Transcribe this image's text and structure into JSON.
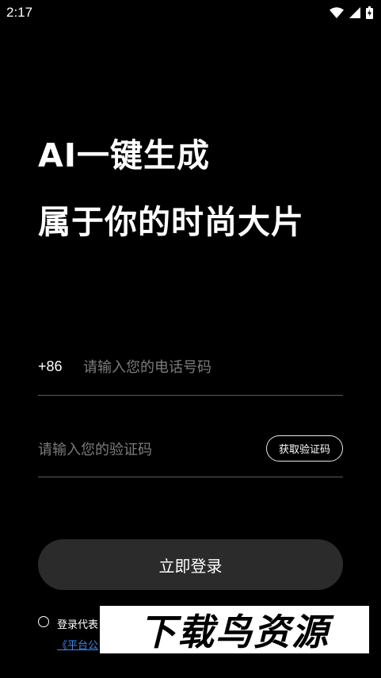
{
  "status_bar": {
    "time": "2:17"
  },
  "headline": {
    "line1": "AI一键生成",
    "line2": "属于你的时尚大片"
  },
  "phone": {
    "country_code": "+86",
    "placeholder": "请输入您的电话号码",
    "value": ""
  },
  "code": {
    "placeholder": "请输入您的验证码",
    "value": "",
    "get_code_label": "获取验证码"
  },
  "login_button_label": "立即登录",
  "agreement": {
    "text": "登录代表",
    "link": "《平台公",
    "checked": false
  },
  "watermark": "下载鸟资源",
  "colors": {
    "background": "#000000",
    "button": "#2b2b2b",
    "link": "#3d8bf0",
    "divider": "#5a5a5a"
  }
}
